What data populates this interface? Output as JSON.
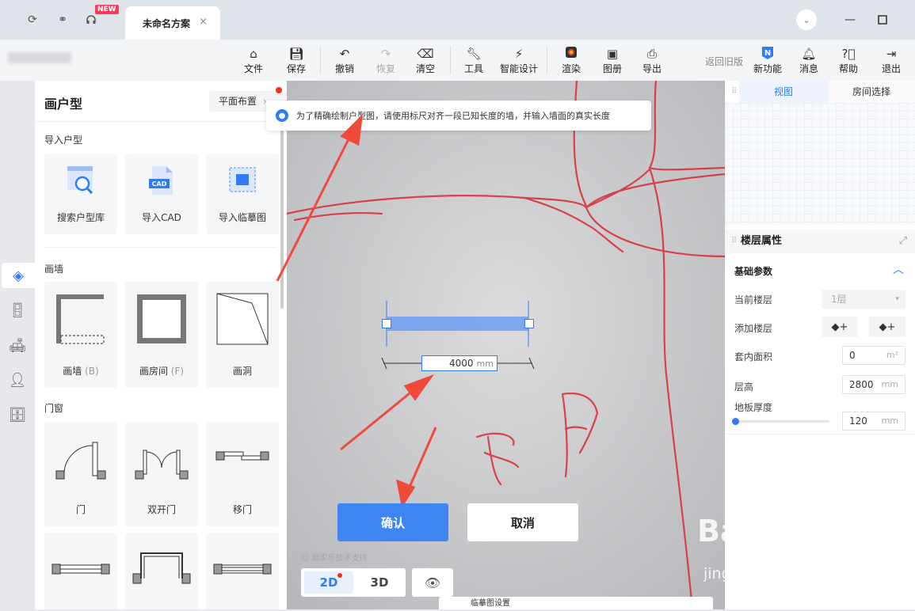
{
  "titlebar": {
    "new_badge": "NEW",
    "tab_title": "未命名方案",
    "tab_close": "×"
  },
  "toolbar": {
    "file": "文件",
    "save": "保存",
    "undo": "撤销",
    "redo": "恢复",
    "clear": "清空",
    "tools": "工具",
    "smart_design": "智能设计",
    "render": "渲染",
    "album": "图册",
    "export": "导出",
    "back_old": "返回旧版",
    "new_feature": "新功能",
    "messages": "消息",
    "help": "帮助",
    "exit": "退出"
  },
  "panel": {
    "title": "画户型",
    "layout_select": "平面布置",
    "section_import": "导入户型",
    "import_items": [
      "搜索户型库",
      "导入CAD",
      "导入临摹图"
    ],
    "section_wall": "画墙",
    "wall_items": [
      {
        "label": "画墙",
        "key": "(B)"
      },
      {
        "label": "画房间",
        "key": "(F)"
      },
      {
        "label": "画洞",
        "key": ""
      }
    ],
    "section_door": "门窗",
    "door_items": [
      "门",
      "双开门",
      "移门"
    ],
    "cad_tag": "CAD"
  },
  "canvas": {
    "notice": "为了精确绘制户型图，请使用标尺对齐一段已知长度的墙，并输入墙面的真实长度",
    "length_value": "4000",
    "length_unit": "mm",
    "confirm": "确认",
    "cancel": "取消",
    "support": "酷家乐技术支持",
    "view_2d": "2D",
    "view_3d": "3D",
    "bottom_label": "临摹图设置"
  },
  "rpanel": {
    "tab_view": "视图",
    "tab_room": "房间选择",
    "floor_props": "楼层属性",
    "basic_params": "基础参数",
    "current_floor_label": "当前楼层",
    "current_floor_value": "1层",
    "add_floor_label": "添加楼层",
    "inner_area_label": "套内面积",
    "inner_area_value": "0",
    "inner_area_unit": "m²",
    "floor_height_label": "层高",
    "floor_height_value": "2800",
    "floor_height_unit": "mm",
    "slab_label": "地板厚度",
    "slab_value": "120",
    "slab_unit": "mm",
    "slab_slider_level": 0.0
  },
  "watermark": {
    "main": "Baidu经验",
    "sub": "jingyan.baidu.com"
  },
  "colors": {
    "accent": "#2f7cf6",
    "confirm": "#3d86f4",
    "alert": "#f0321e",
    "sketch": "#d8323c"
  }
}
